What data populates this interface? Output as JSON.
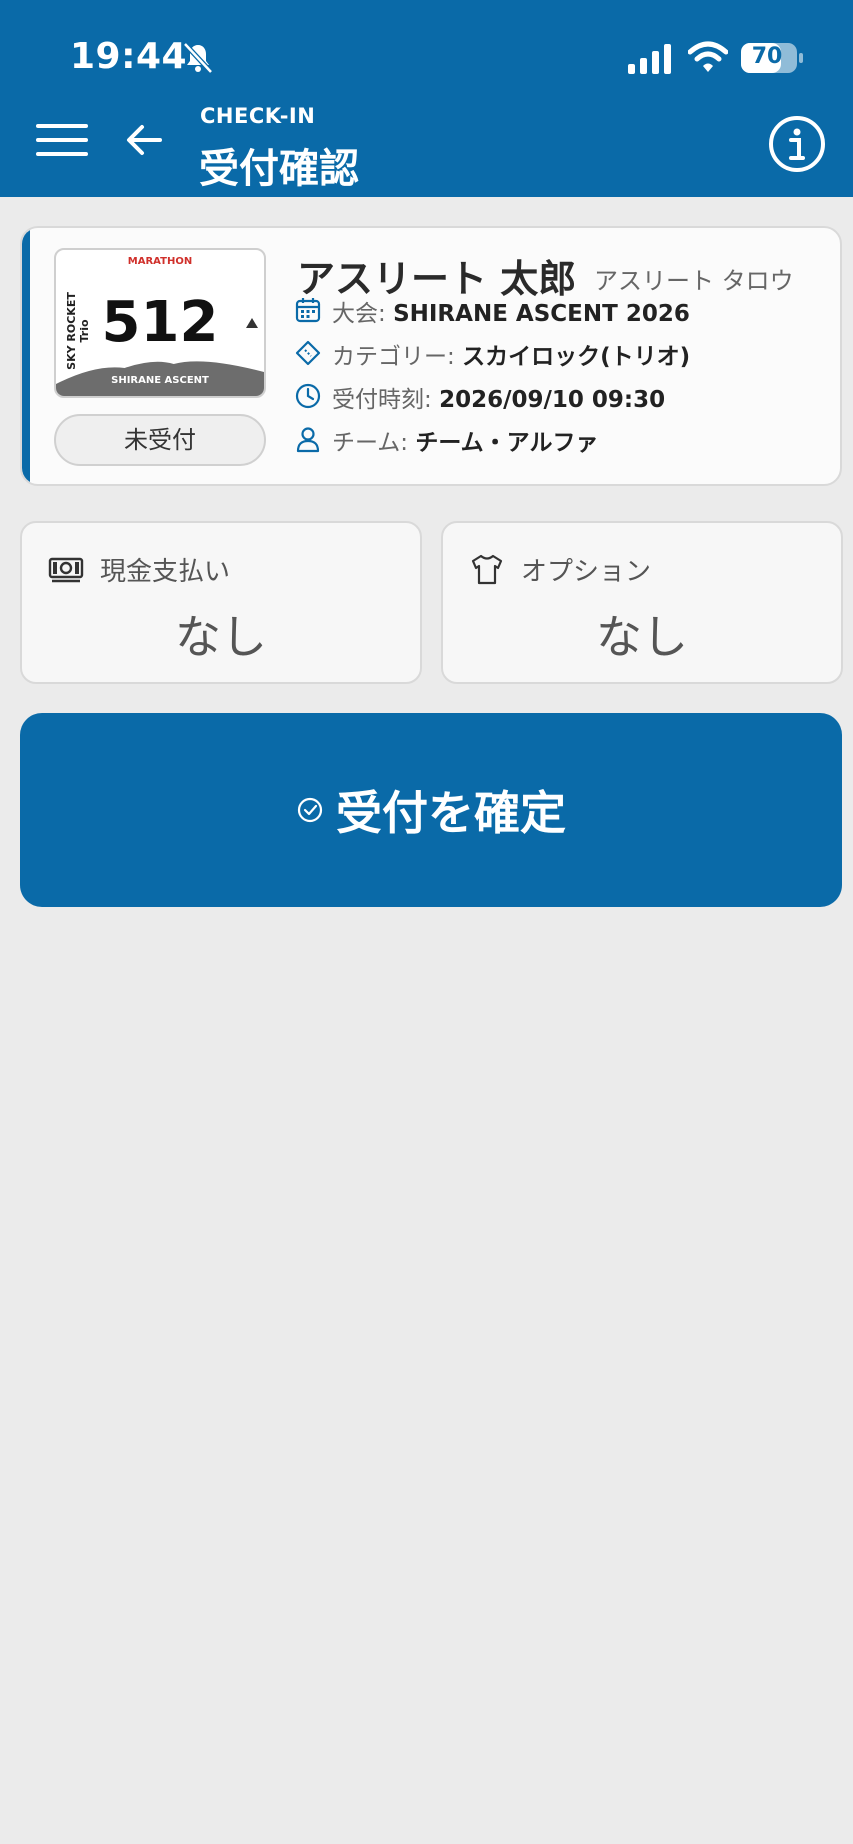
{
  "status_bar": {
    "time": "19:44",
    "battery": "70",
    "icons": [
      "bell-slash-icon",
      "signal-icon",
      "wifi-icon",
      "battery-icon"
    ]
  },
  "header": {
    "subtitle": "CHECK-IN",
    "title": "受付確認",
    "icons": [
      "menu-icon",
      "back-arrow-icon",
      "info-icon"
    ]
  },
  "athlete": {
    "bib_number": "512",
    "bib_brand": "MARATHON",
    "bib_side_text": "SKY ROCKET Trio",
    "bib_event": "SHIRANE ASCENT",
    "status": "未受付",
    "name": "アスリート 太郎",
    "name_kana": "アスリート タロウ",
    "details": [
      {
        "icon": "calendar-icon",
        "label": "大会: ",
        "value": "SHIRANE ASCENT 2026"
      },
      {
        "icon": "ticket-icon",
        "label": "カテゴリー: ",
        "value": "スカイロック(トリオ)"
      },
      {
        "icon": "clock-icon",
        "label": "受付時刻: ",
        "value": "2026/09/10 09:30"
      },
      {
        "icon": "person-icon",
        "label": "チーム: ",
        "value": "チーム・アルファ"
      }
    ]
  },
  "tiles": {
    "cash": {
      "label": "現金支払い",
      "value": "なし",
      "icon": "cash-icon"
    },
    "option": {
      "label": "オプション",
      "value": "なし",
      "icon": "tshirt-icon"
    }
  },
  "confirm": {
    "label": "受付を確定",
    "icon": "check-circle-icon"
  },
  "colors": {
    "primary": "#0a6aa8",
    "background": "#ebebeb",
    "bib_red": "#d0302b"
  }
}
